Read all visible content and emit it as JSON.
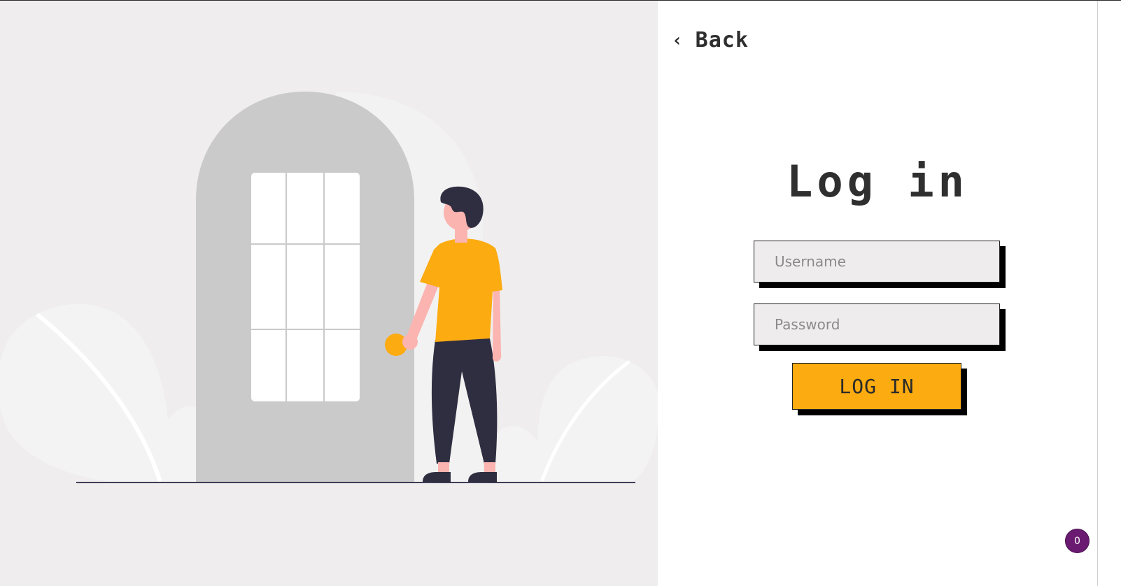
{
  "nav": {
    "back_icon": "chevron-left-icon",
    "back_glyph": "‹",
    "back_label": "Back"
  },
  "form": {
    "title": "Log in",
    "username_placeholder": "Username",
    "username_value": "",
    "password_placeholder": "Password",
    "password_value": "",
    "submit_label": "LOG IN"
  },
  "badge": {
    "count": "0"
  },
  "illustration": {
    "subject": "person standing at arched door",
    "colors": {
      "background": "#efeded",
      "door": "#cacaca",
      "window": "#ffffff",
      "shirt": "#fcab10",
      "skin": "#fbb4b0",
      "hair_pants": "#2f2e41",
      "leaf": "#f3f3f3",
      "ground": "#3f3d56"
    }
  },
  "theme": {
    "accent": "#fcab10",
    "badge_bg": "#6a1b71",
    "input_bg": "#eeecec",
    "text": "#2f2f2f"
  }
}
